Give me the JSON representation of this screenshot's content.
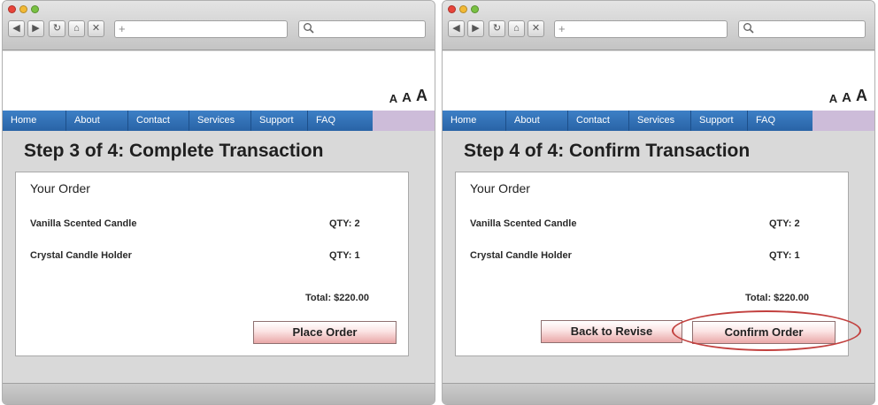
{
  "colors": {
    "nav_blue": "#2f6fb5",
    "nav_filler": "#cdbcd9",
    "button_pink": "#e9a8a8",
    "highlight_red": "#c2403e",
    "dot_red": "#e8443a",
    "dot_yellow": "#f2b935",
    "dot_green": "#79c142"
  },
  "browser_chrome": {
    "toolbar_icons": [
      "back-arrow-icon",
      "forward-arrow-icon",
      "reload-icon",
      "home-icon",
      "stop-icon"
    ],
    "address_plus": "+",
    "search_icon": "magnifier-icon"
  },
  "font_size_controls": [
    "A",
    "A",
    "A"
  ],
  "nav": [
    "Home",
    "About",
    "Contact",
    "Services",
    "Support",
    "FAQ"
  ],
  "screens": [
    {
      "step_title": "Step 3 of 4: Complete Transaction",
      "order_heading": "Your Order",
      "items": [
        {
          "name": "Vanilla Scented Candle",
          "qty": "QTY: 2"
        },
        {
          "name": "Crystal Candle Holder",
          "qty": "QTY: 1"
        }
      ],
      "total": "Total: $220.00",
      "primary_button": "Place Order"
    },
    {
      "step_title": "Step 4 of 4: Confirm Transaction",
      "order_heading": "Your Order",
      "items": [
        {
          "name": "Vanilla Scented Candle",
          "qty": "QTY: 2"
        },
        {
          "name": "Crystal Candle Holder",
          "qty": "QTY: 1"
        }
      ],
      "total": "Total: $220.00",
      "secondary_button": "Back to Revise",
      "primary_button": "Confirm Order"
    }
  ]
}
